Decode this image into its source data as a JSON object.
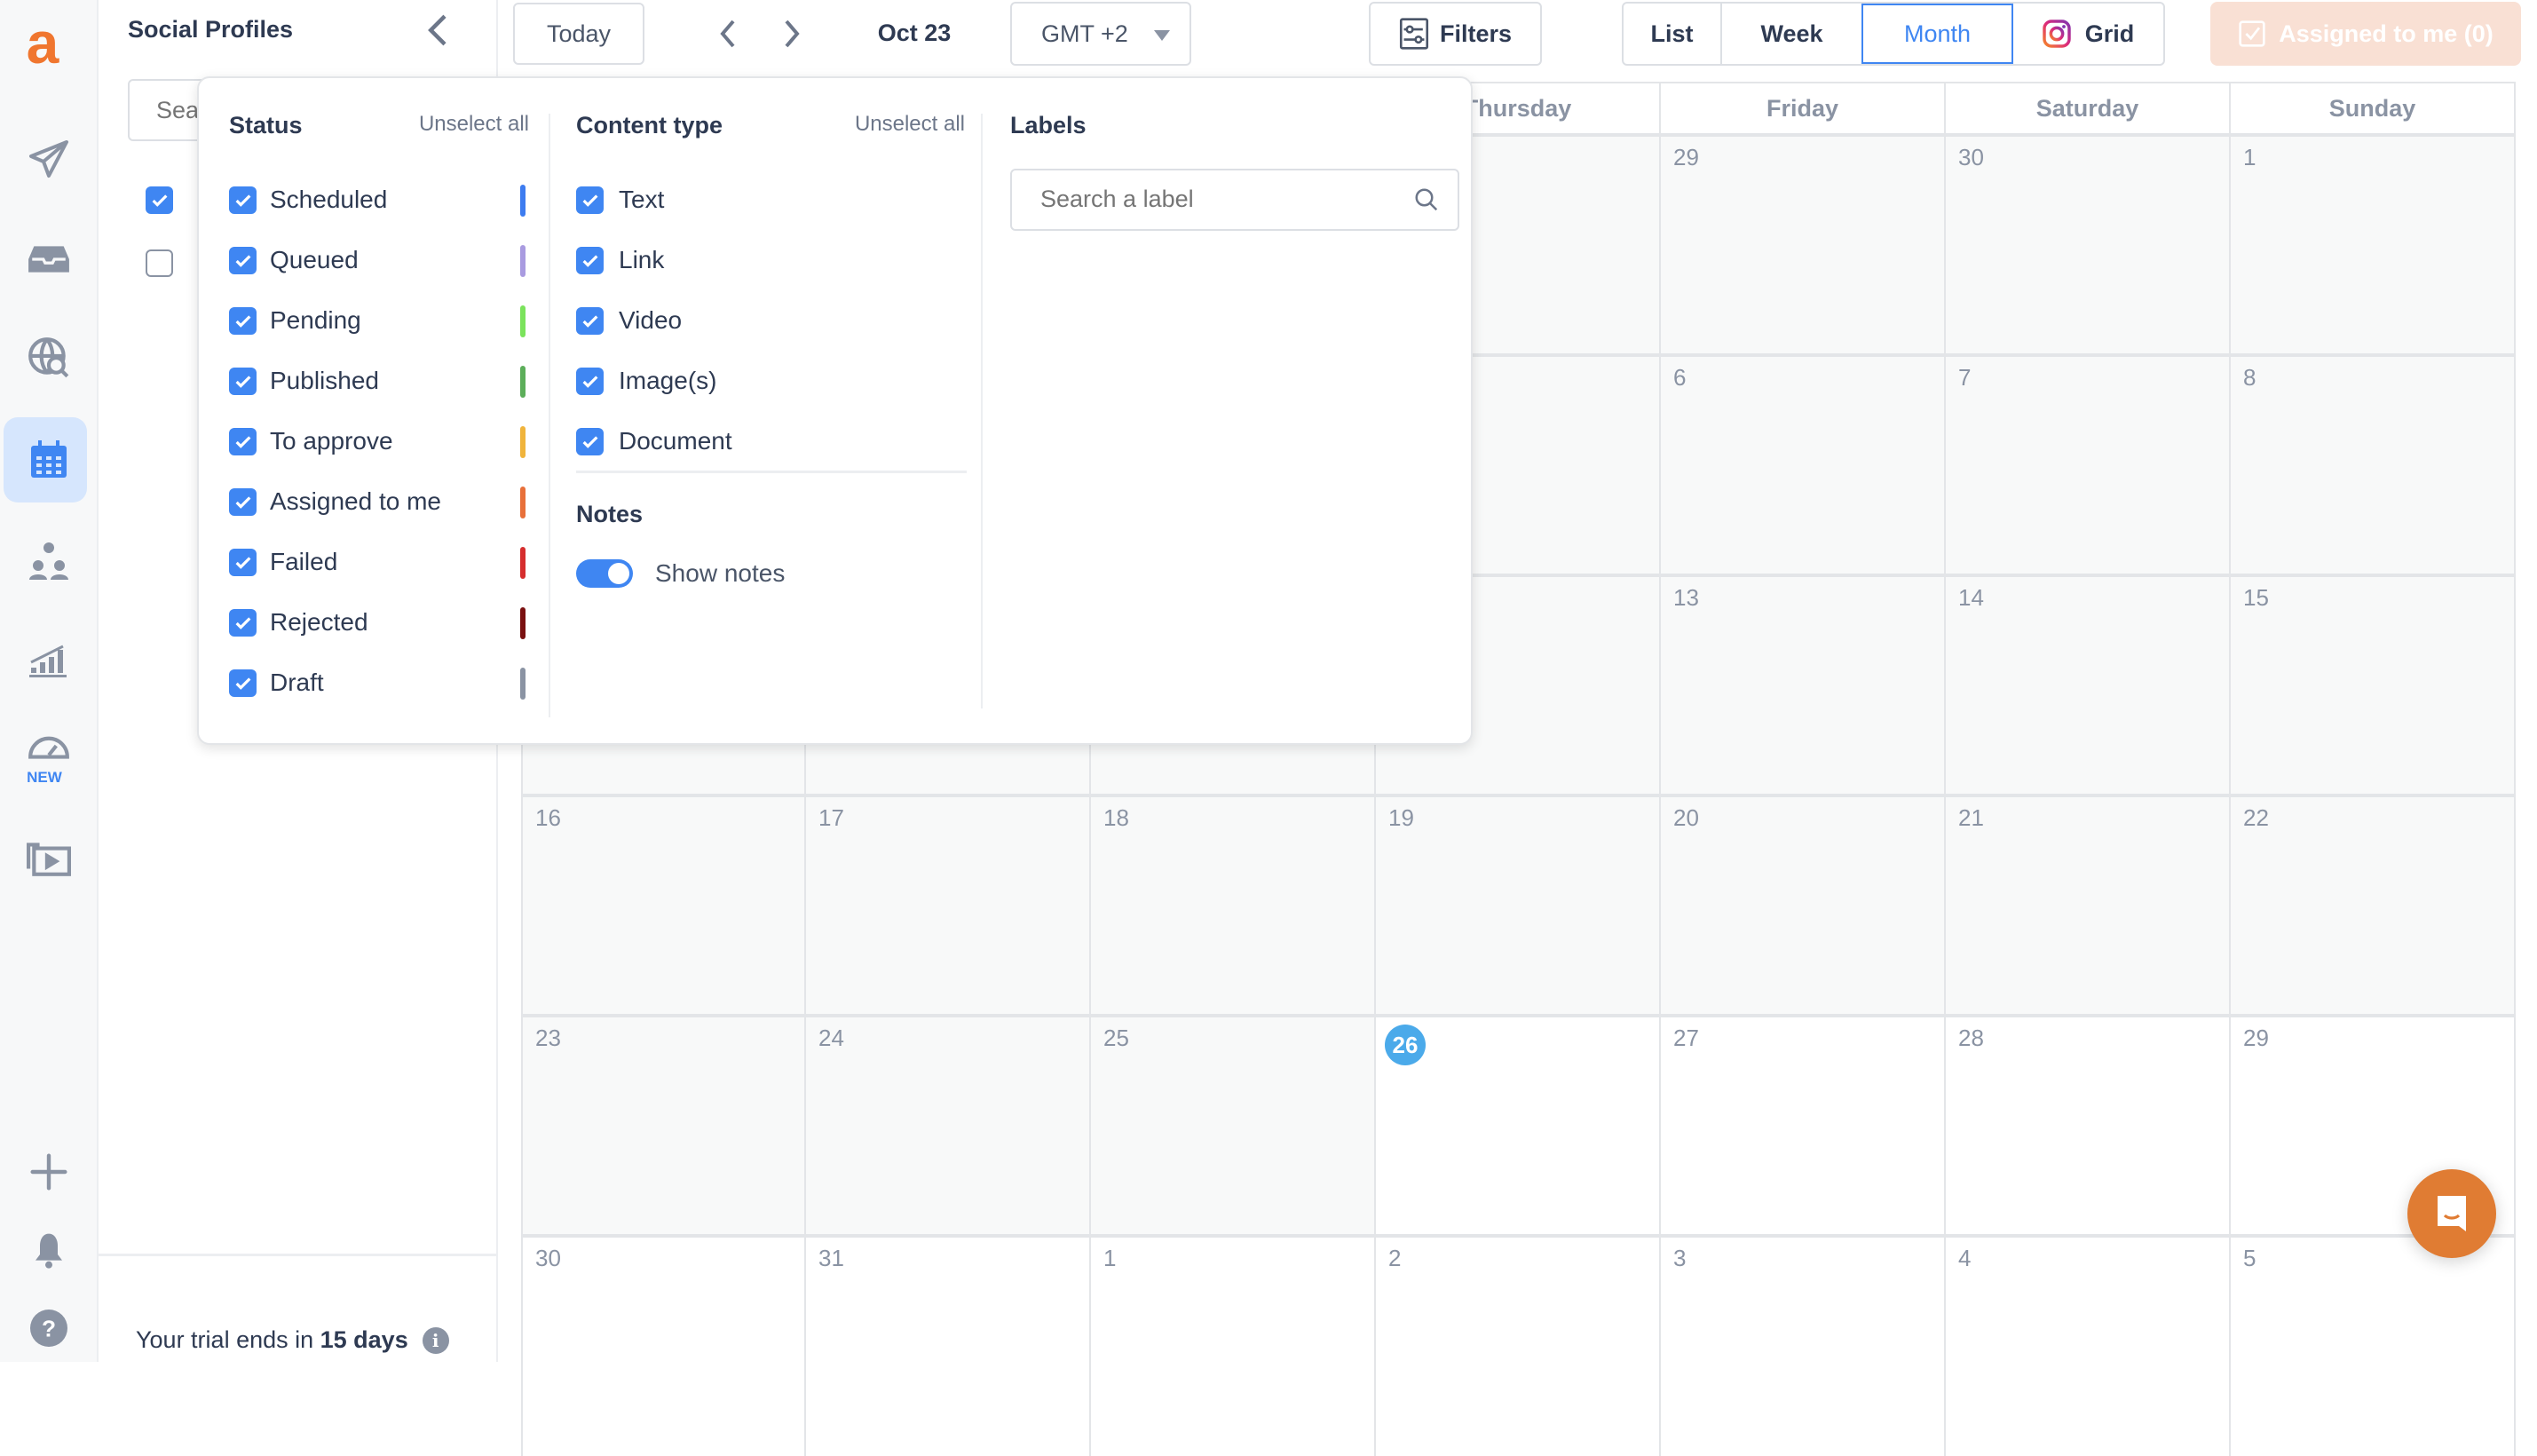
{
  "rail": {
    "items": [
      {
        "icon": "send-icon",
        "label": ""
      },
      {
        "icon": "inbox-icon",
        "label": ""
      },
      {
        "icon": "globe-search-icon",
        "label": ""
      },
      {
        "icon": "calendar-icon",
        "label": "",
        "active": true
      },
      {
        "icon": "team-icon",
        "label": ""
      },
      {
        "icon": "analytics-icon",
        "label": ""
      },
      {
        "icon": "dashboard-icon",
        "label": "NEW"
      },
      {
        "icon": "media-library-icon",
        "label": ""
      }
    ],
    "bottom": [
      "plus-icon",
      "bell-icon",
      "help-icon"
    ],
    "logo": "a",
    "accent": "#f0762f",
    "active_color": "#3f86f2"
  },
  "profiles": {
    "title": "Social Profiles",
    "search_placeholder": "Search",
    "items": [
      {
        "checked": true
      },
      {
        "checked": false
      }
    ],
    "trial": {
      "prefix": "Your trial ends in ",
      "days": "15 days"
    }
  },
  "toolbar": {
    "today": "Today",
    "period": "Oct 23",
    "timezone": "GMT +2",
    "filters": "Filters",
    "views": [
      {
        "label": "List"
      },
      {
        "label": "Week"
      },
      {
        "label": "Month",
        "active": true
      },
      {
        "label": "Grid"
      }
    ],
    "assigned": "Assigned to me (0)"
  },
  "calendar": {
    "days": [
      "",
      "",
      "",
      "Thursday",
      "Friday",
      "Saturday",
      "Sunday"
    ],
    "weeks": [
      [
        null,
        null,
        null,
        null,
        "29",
        "30",
        "1"
      ],
      [
        null,
        null,
        null,
        null,
        "6",
        "7",
        "8"
      ],
      [
        null,
        null,
        null,
        null,
        "13",
        "14",
        "15"
      ],
      [
        "16",
        "17",
        "18",
        "19",
        "20",
        "21",
        "22"
      ],
      [
        "23",
        "24",
        "25",
        "26",
        "27",
        "28",
        "29"
      ],
      [
        "30",
        "31",
        "1",
        "2",
        "3",
        "4",
        "5"
      ]
    ],
    "today": "26"
  },
  "filters": {
    "status": {
      "title": "Status",
      "unselect": "Unselect all",
      "items": [
        {
          "label": "Scheduled",
          "checked": true,
          "color": "#3d7cf0"
        },
        {
          "label": "Queued",
          "checked": true,
          "color": "#a99be0"
        },
        {
          "label": "Pending",
          "checked": true,
          "color": "#7be35c"
        },
        {
          "label": "Published",
          "checked": true,
          "color": "#5cae5a"
        },
        {
          "label": "To approve",
          "checked": true,
          "color": "#f0b43c"
        },
        {
          "label": "Assigned to me",
          "checked": true,
          "color": "#e8703a"
        },
        {
          "label": "Failed",
          "checked": true,
          "color": "#d62e2e"
        },
        {
          "label": "Rejected",
          "checked": true,
          "color": "#7a1010"
        },
        {
          "label": "Draft",
          "checked": true,
          "color": "#8a93a3"
        }
      ]
    },
    "content": {
      "title": "Content type",
      "unselect": "Unselect all",
      "items": [
        {
          "label": "Text",
          "checked": true
        },
        {
          "label": "Link",
          "checked": true
        },
        {
          "label": "Video",
          "checked": true
        },
        {
          "label": "Image(s)",
          "checked": true
        },
        {
          "label": "Document",
          "checked": true
        }
      ]
    },
    "notes": {
      "title": "Notes",
      "toggle_label": "Show notes",
      "on": true
    },
    "labels": {
      "title": "Labels",
      "search_placeholder": "Search a label"
    }
  }
}
